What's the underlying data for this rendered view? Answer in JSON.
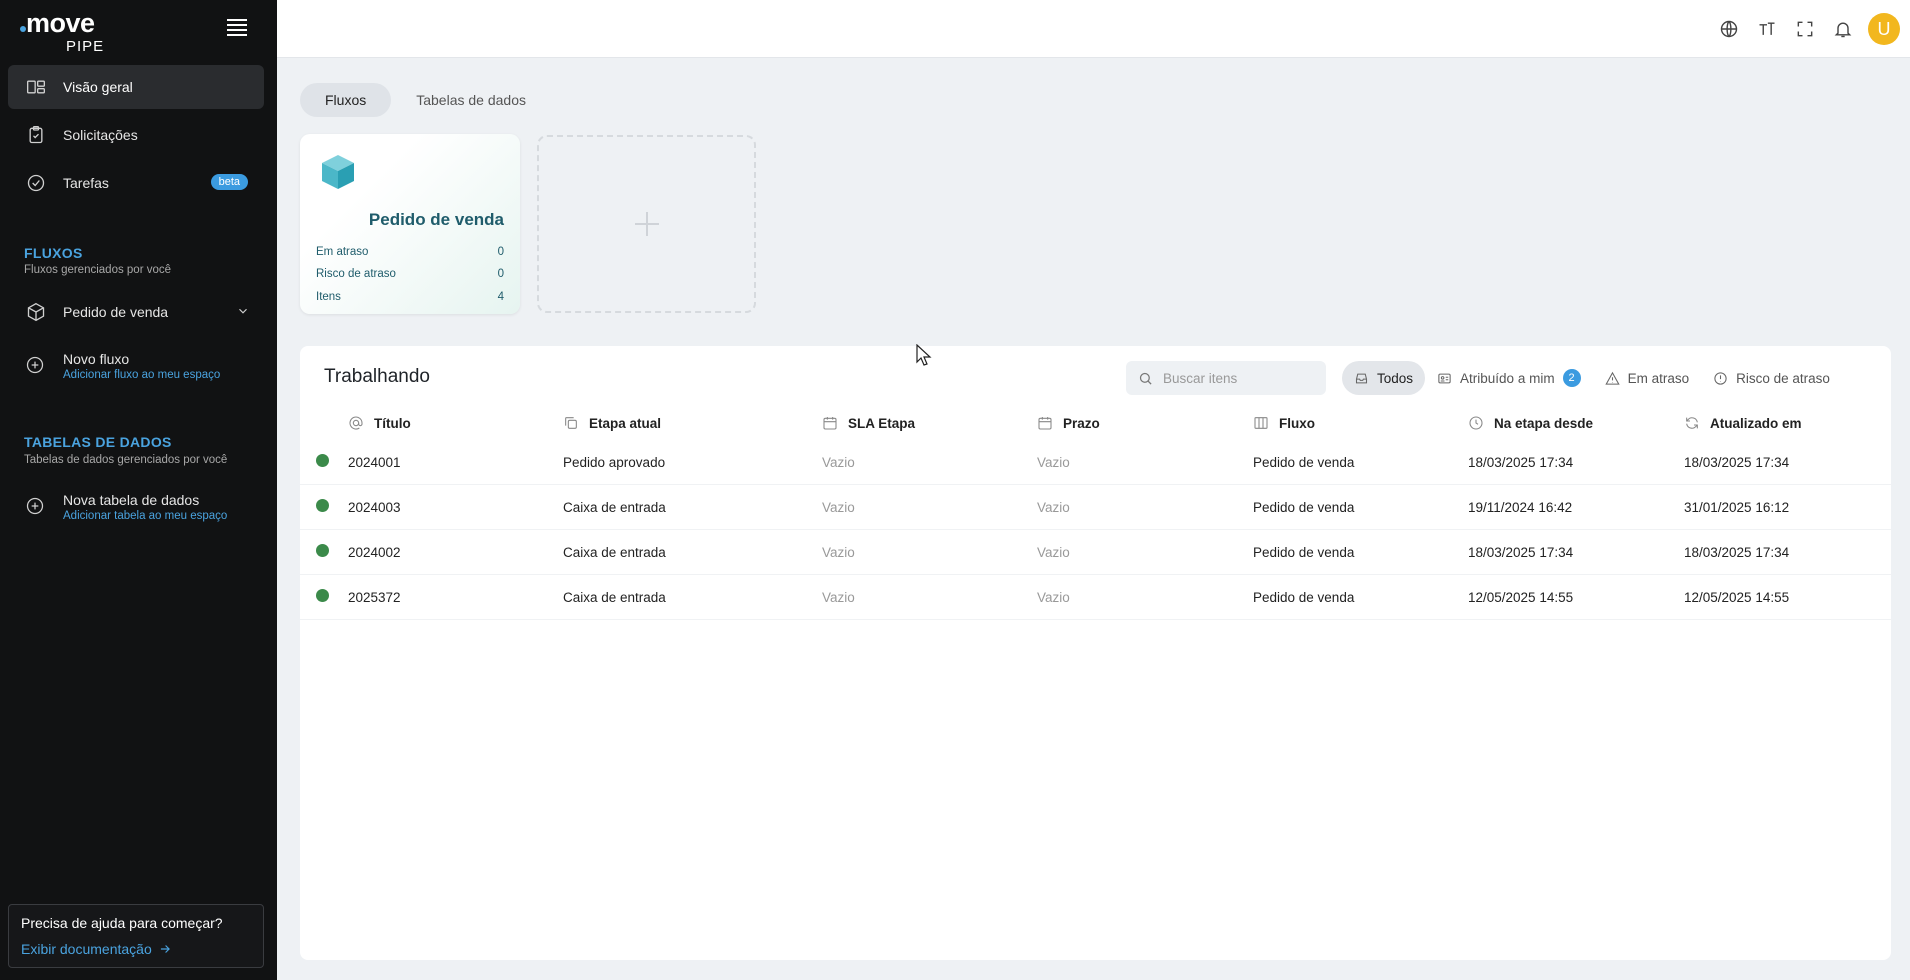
{
  "app": {
    "logo_main": "move",
    "logo_sub": "PIPE"
  },
  "sidebar": {
    "nav": [
      {
        "label": "Visão geral",
        "icon": "overview-icon"
      },
      {
        "label": "Solicitações",
        "icon": "clipboard-icon"
      },
      {
        "label": "Tarefas",
        "icon": "check-circle-icon",
        "badge": "beta"
      }
    ],
    "fluxos_title": "FLUXOS",
    "fluxos_sub": "Fluxos gerenciados por você",
    "flow_item": "Pedido de venda",
    "novo_fluxo": "Novo fluxo",
    "novo_fluxo_sub": "Adicionar fluxo ao meu espaço",
    "tabelas_title": "TABELAS DE DADOS",
    "tabelas_sub": "Tabelas de dados gerenciados por você",
    "nova_tabela": "Nova tabela de dados",
    "nova_tabela_sub": "Adicionar tabela ao meu espaço",
    "help_question": "Precisa de ajuda para começar?",
    "help_link": "Exibir documentação"
  },
  "topbar": {
    "avatar_letter": "U"
  },
  "tabs": [
    "Fluxos",
    "Tabelas de dados"
  ],
  "flow_card": {
    "title": "Pedido de venda",
    "stats": [
      {
        "label": "Em atraso",
        "value": "0"
      },
      {
        "label": "Risco de atraso",
        "value": "0"
      },
      {
        "label": "Itens",
        "value": "4"
      }
    ]
  },
  "panel": {
    "title": "Trabalhando",
    "search_placeholder": "Buscar itens",
    "filters": [
      {
        "label": "Todos"
      },
      {
        "label": "Atribuído a mim",
        "count": "2"
      },
      {
        "label": "Em atraso"
      },
      {
        "label": "Risco de atraso"
      }
    ],
    "columns": [
      "Título",
      "Etapa atual",
      "SLA Etapa",
      "Prazo",
      "Fluxo",
      "Na etapa desde",
      "Atualizado em"
    ],
    "rows": [
      [
        "2024001",
        "Pedido aprovado",
        "Vazio",
        "Vazio",
        "Pedido de venda",
        "18/03/2025 17:34",
        "18/03/2025 17:34"
      ],
      [
        "2024003",
        "Caixa de entrada",
        "Vazio",
        "Vazio",
        "Pedido de venda",
        "19/11/2024 16:42",
        "31/01/2025 16:12"
      ],
      [
        "2024002",
        "Caixa de entrada",
        "Vazio",
        "Vazio",
        "Pedido de venda",
        "18/03/2025 17:34",
        "18/03/2025 17:34"
      ],
      [
        "2025372",
        "Caixa de entrada",
        "Vazio",
        "Vazio",
        "Pedido de venda",
        "12/05/2025 14:55",
        "12/05/2025 14:55"
      ]
    ]
  }
}
